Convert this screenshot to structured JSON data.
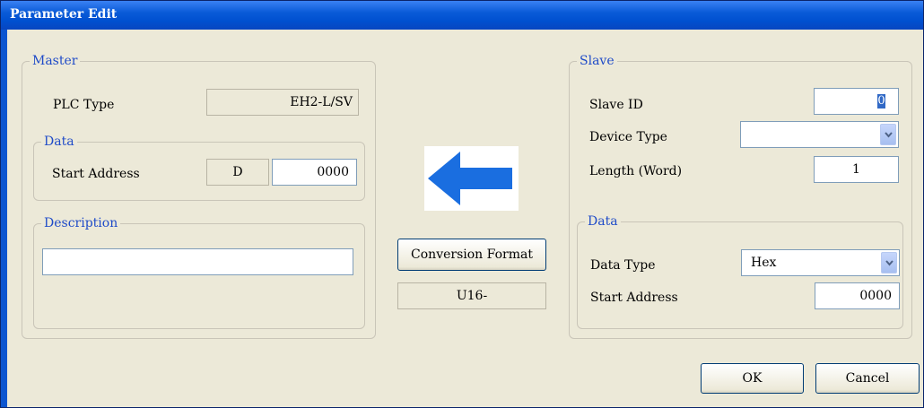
{
  "window": {
    "title": "Parameter Edit"
  },
  "master": {
    "legend": "Master",
    "plc_type_label": "PLC Type",
    "plc_type_value": "EH2-L/SV",
    "data": {
      "legend": "Data",
      "start_address_label": "Start Address",
      "device_prefix": "D",
      "start_address_value": "0000"
    },
    "description": {
      "legend": "Description",
      "value": ""
    }
  },
  "center": {
    "arrow_icon": "left-arrow-icon",
    "arrow_color": "#1a6ee0",
    "conversion_button_label": "Conversion Format",
    "conversion_value": "U16-"
  },
  "slave": {
    "legend": "Slave",
    "slave_id_label": "Slave ID",
    "slave_id_value": "0",
    "device_type_label": "Device Type",
    "device_type_value": "",
    "length_label": "Length (Word)",
    "length_value": "1",
    "data": {
      "legend": "Data",
      "data_type_label": "Data Type",
      "data_type_value": "Hex",
      "start_address_label": "Start Address",
      "start_address_value": "0000"
    }
  },
  "buttons": {
    "ok": "OK",
    "cancel": "Cancel"
  }
}
